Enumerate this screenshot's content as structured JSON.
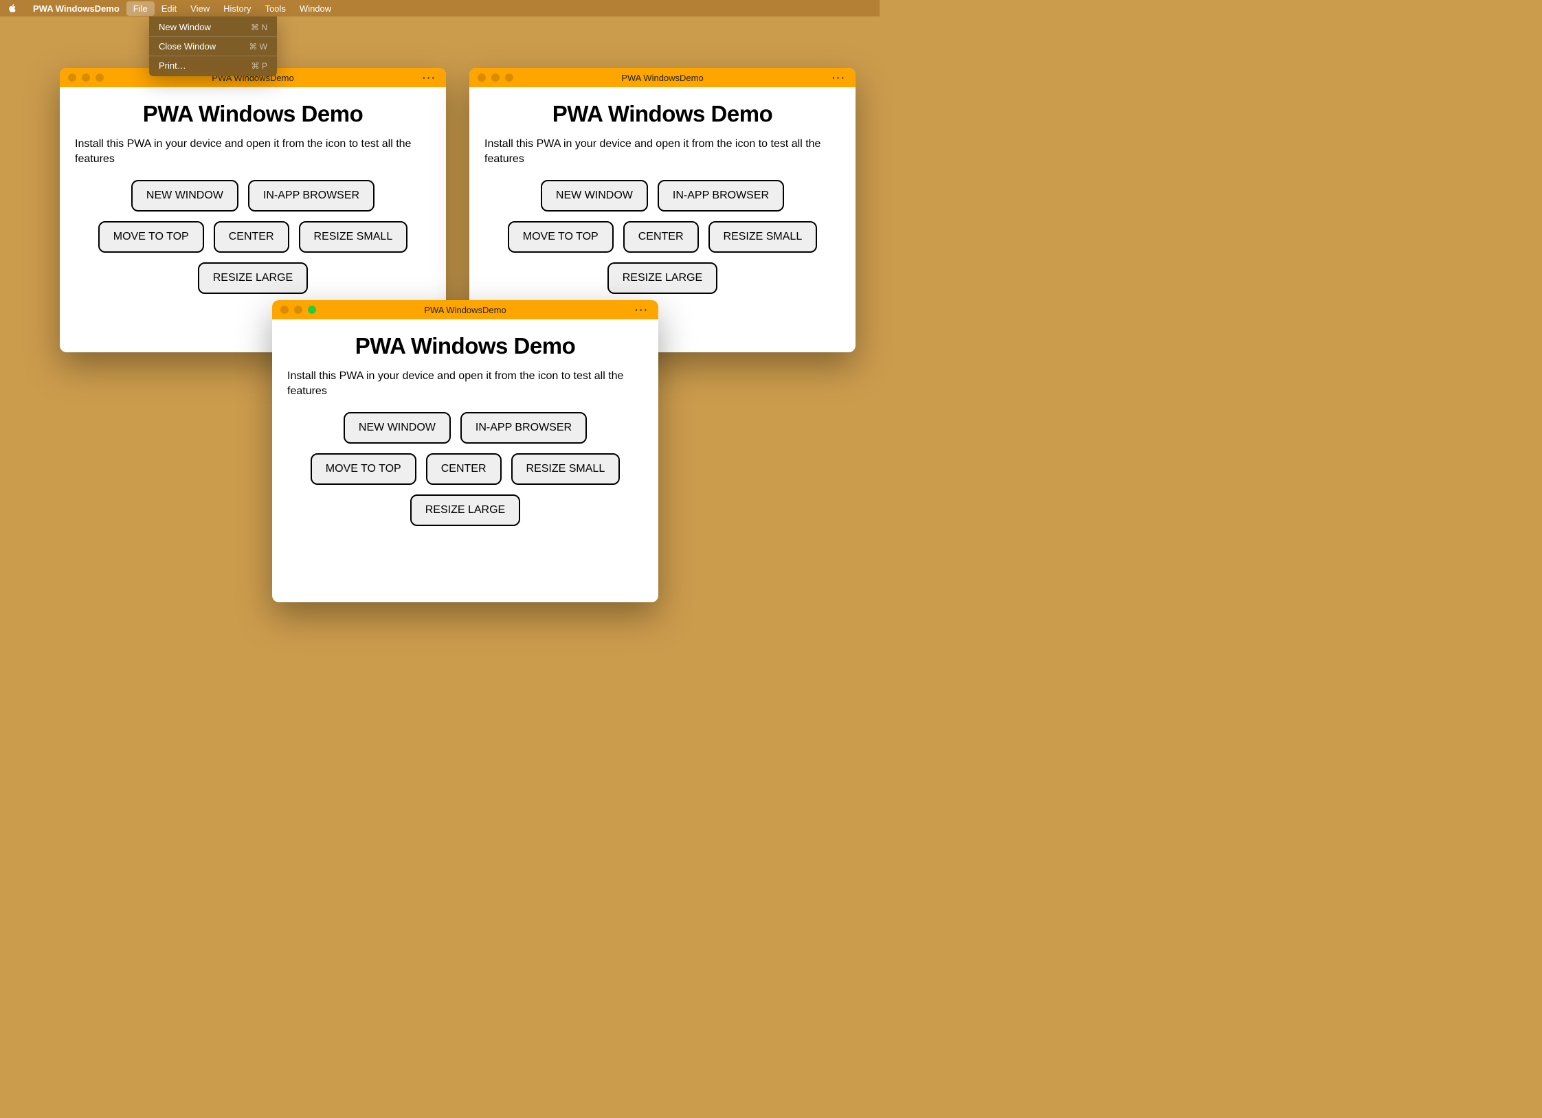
{
  "menubar": {
    "app_name": "PWA WindowsDemo",
    "items": [
      "File",
      "Edit",
      "View",
      "History",
      "Tools",
      "Window"
    ]
  },
  "file_menu": {
    "items": [
      {
        "label": "New Window",
        "shortcut": "⌘ N"
      },
      {
        "label": "Close Window",
        "shortcut": "⌘ W"
      },
      {
        "label": "Print…",
        "shortcut": "⌘ P"
      }
    ]
  },
  "window": {
    "title": "PWA WindowsDemo",
    "heading": "PWA Windows Demo",
    "description": "Install this PWA in your device and open it from the icon to test all the features",
    "menu_dots": "···",
    "buttons": [
      "NEW WINDOW",
      "IN-APP BROWSER",
      "MOVE TO TOP",
      "CENTER",
      "RESIZE SMALL",
      "RESIZE LARGE"
    ]
  }
}
